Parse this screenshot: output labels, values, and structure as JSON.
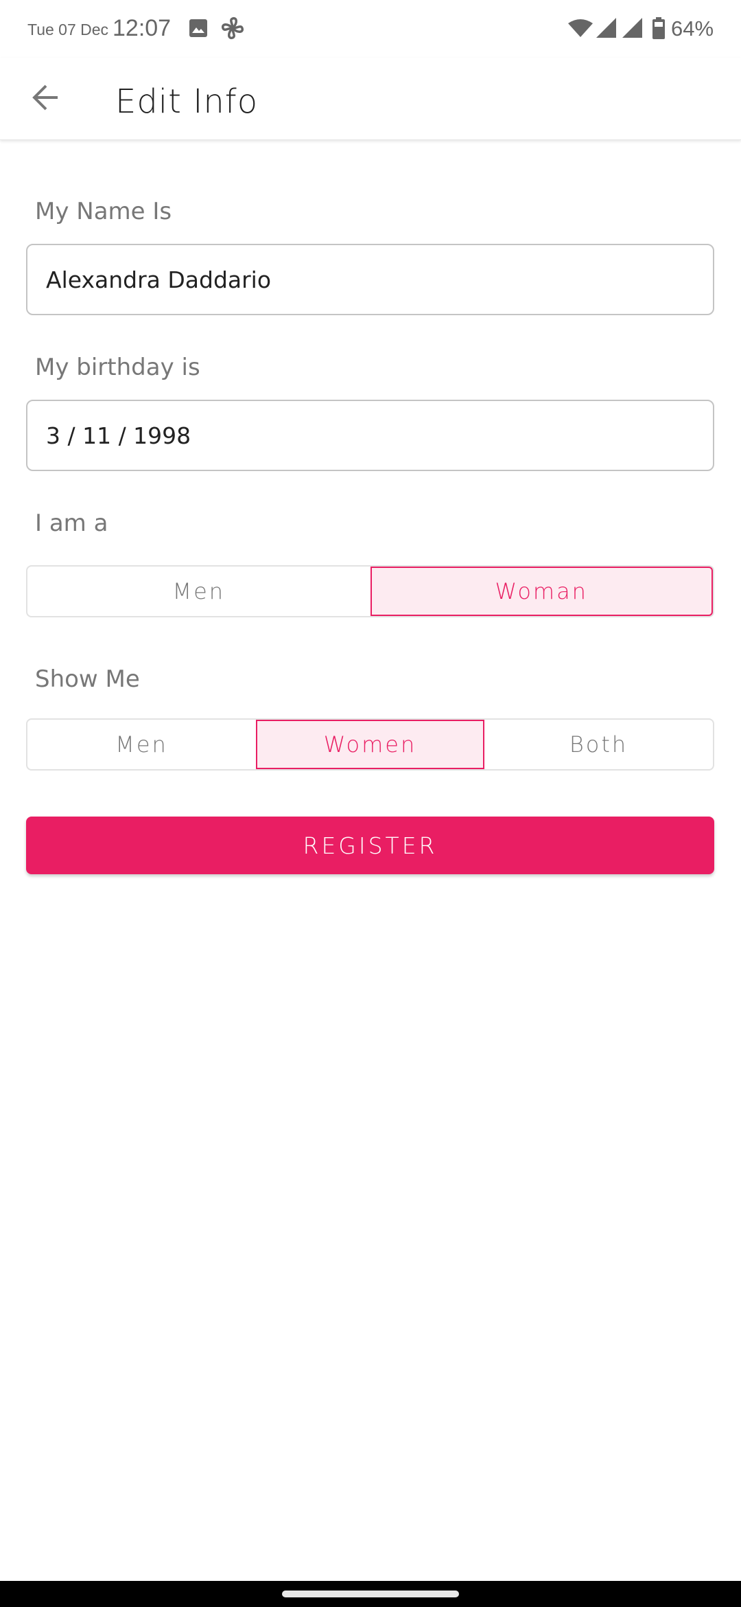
{
  "status_bar": {
    "date": "Tue 07 Dec",
    "time": "12:07",
    "notification_icons": [
      "image-icon",
      "pinwheel-icon"
    ],
    "system_icons": [
      "wifi-icon",
      "signal-icon",
      "signal-icon",
      "battery-icon"
    ],
    "battery_percent": "64%"
  },
  "app_bar": {
    "back_icon": "arrow-left-icon",
    "title": "Edit Info"
  },
  "form": {
    "name": {
      "label": "My Name Is",
      "value": "Alexandra Daddario"
    },
    "birthday": {
      "label": "My birthday is",
      "value": "3 / 11 / 1998"
    },
    "gender": {
      "label": "I am a",
      "options": [
        "Men",
        "Woman"
      ],
      "selected": "Woman"
    },
    "show_me": {
      "label": "Show Me",
      "options": [
        "Men",
        "Women",
        "Both"
      ],
      "selected": "Women"
    },
    "submit_label": "REGISTER"
  },
  "colors": {
    "accent": "#e91e63",
    "accent_light": "#fdebf1",
    "label_gray": "#777777",
    "text_dark": "#222222"
  }
}
